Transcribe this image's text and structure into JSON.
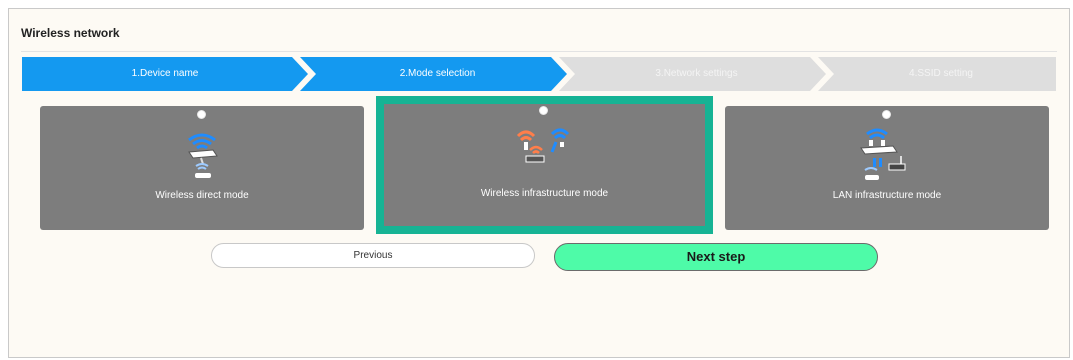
{
  "panel": {
    "title": "Wireless network"
  },
  "steps": [
    {
      "label": "1.Device name",
      "state": "done"
    },
    {
      "label": "2.Mode selection",
      "state": "active"
    },
    {
      "label": "3.Network settings",
      "state": "pending"
    },
    {
      "label": "4.SSID setting",
      "state": "pending"
    }
  ],
  "modes": [
    {
      "label": "Wireless direct mode",
      "icon": "wireless-direct-icon",
      "selected": false
    },
    {
      "label": "Wireless infrastructure mode",
      "icon": "wireless-infrastructure-icon",
      "selected": true
    },
    {
      "label": "LAN infrastructure mode",
      "icon": "lan-infrastructure-icon",
      "selected": false
    }
  ],
  "buttons": {
    "previous": "Previous",
    "next": "Next step"
  },
  "colors": {
    "step_active": "#1499f0",
    "step_pending": "#dedede",
    "selected_border": "#16b394",
    "card": "#7d7d7d",
    "next_button": "#4efba8"
  }
}
